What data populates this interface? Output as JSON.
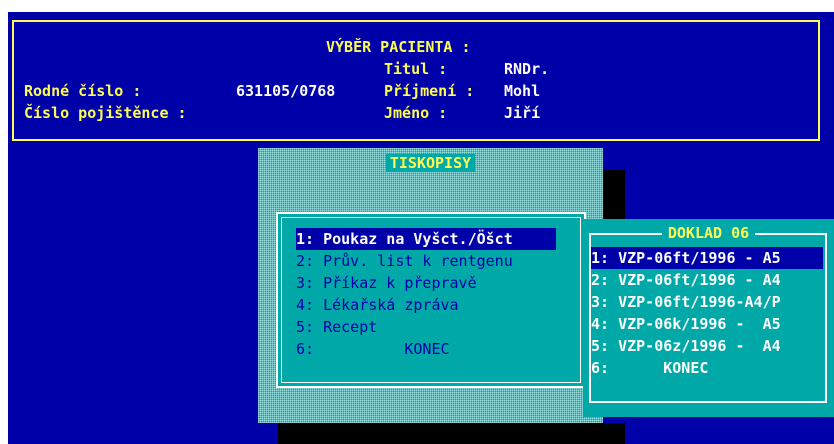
{
  "header": {
    "title": "VÝBĚR PACIENTA :",
    "titul_label": "Titul :",
    "titul_value": "RNDr.",
    "rodne_label": "Rodné číslo :",
    "rodne_value": "631105/0768",
    "prijmeni_label": "Příjmení :",
    "prijmeni_value": "Mohl",
    "pojistence_label": "Číslo pojištěnce :",
    "jmeno_label": "Jméno :",
    "jmeno_value": "Jiří"
  },
  "tiskopisy": {
    "title": "TISKOPISY",
    "items": [
      {
        "label": "1: Poukaz na Vyšct./Öšct"
      },
      {
        "label": "2: Prův. list k rentgenu"
      },
      {
        "label": "3: Příkaz k přepravě"
      },
      {
        "label": "4: Lékařská zpráva"
      },
      {
        "label": "5: Recept"
      },
      {
        "label": "6:          KONEC"
      }
    ]
  },
  "doklad": {
    "title": "DOKLAD 06",
    "items": [
      {
        "label": "1: VZP-06ft/1996 - A5"
      },
      {
        "label": "2: VZP-06ft/1996 - A4"
      },
      {
        "label": "3: VZP-06ft/1996-A4/P"
      },
      {
        "label": "4: VZP-06k/1996 -  A5"
      },
      {
        "label": "5: VZP-06z/1996 -  A4"
      },
      {
        "label": "6:      KONEC"
      }
    ]
  },
  "colors": {
    "background": "#0000a8",
    "highlight": "#fcfc54",
    "popup": "#00a8a8",
    "text_light": "#fcfcfc"
  }
}
